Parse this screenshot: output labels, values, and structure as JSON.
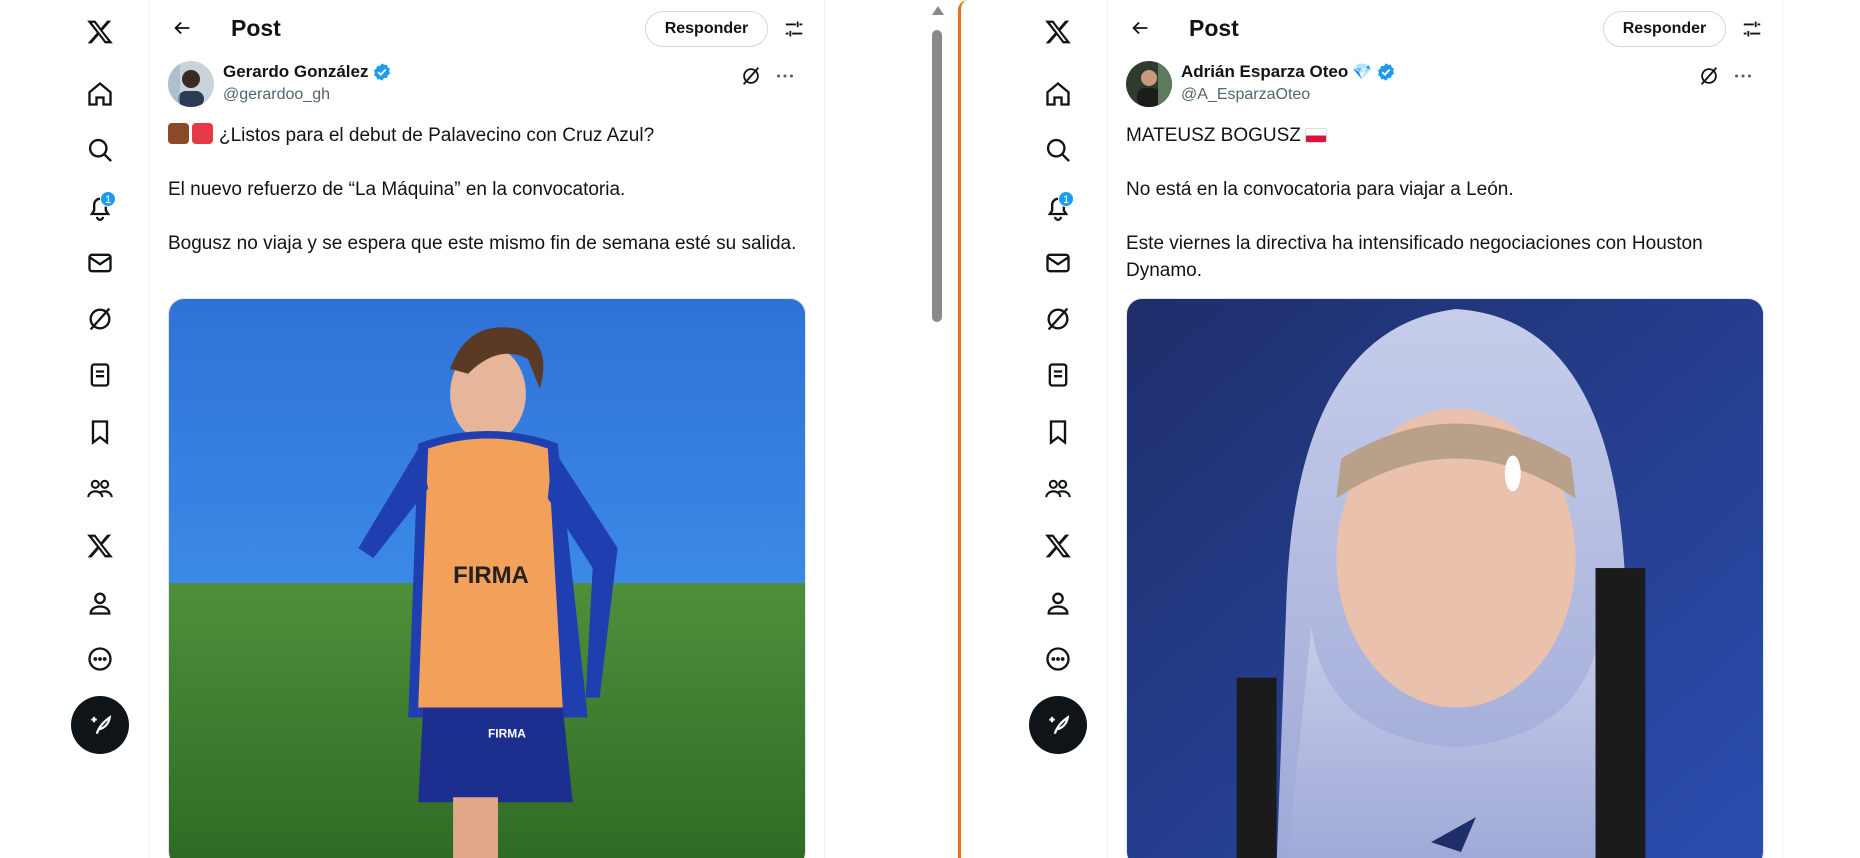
{
  "nav": {
    "items": [
      "x-logo-icon",
      "home-icon",
      "search-icon",
      "bell-icon",
      "mail-icon",
      "grok-icon",
      "lists-icon",
      "bookmark-icon",
      "communities-icon",
      "premium-icon",
      "profile-icon",
      "more-circle-icon"
    ],
    "notification_badge": "1",
    "compose_icon": "feather-plus-icon"
  },
  "accent_color": "#1d9bf0",
  "active_pane_border_color": "#e8721c",
  "columns": [
    {
      "title": "Post",
      "reply_label": "Responder",
      "author": {
        "name": "Gerardo González",
        "handle": "@gerardoo_gh",
        "verified": true
      },
      "paragraphs": [
        "¿Listos para el debut de Palavecino con Cruz Azul?",
        "El nuevo refuerzo de “La Máquina” en la convocatoria.",
        "Bogusz no viaja y se espera que este mismo fin de semana esté su salida."
      ],
      "leading_emojis": [
        "train-emoji",
        "siren-emoji"
      ],
      "media_texts": [
        "FIRMA",
        "FIRMA"
      ]
    },
    {
      "title": "Post",
      "reply_label": "Responder",
      "author": {
        "name": "Adrián Esparza Oteo",
        "name_suffix": "💎",
        "handle": "@A_EsparzaOteo",
        "verified": true
      },
      "paragraphs": [
        "MATEUSZ BOGUSZ",
        "No está en la convocatoria para viajar a León.",
        "Este viernes la directiva ha intensificado negociaciones con Houston Dynamo."
      ],
      "heading_flag": "poland-flag"
    }
  ]
}
